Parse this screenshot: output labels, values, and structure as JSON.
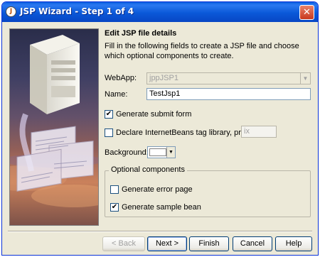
{
  "window": {
    "title": "JSP Wizard - Step 1 of 4",
    "title_icon": "wizard-icon",
    "close_glyph": "✕"
  },
  "header": {
    "heading": "Edit JSP file details",
    "description": "Fill in the following fields to create a JSP file and choose which optional components to create."
  },
  "form": {
    "webapp_label": "WebApp:",
    "webapp_value": "jppJSP1",
    "name_label": "Name:",
    "name_value": "TestJsp1",
    "generate_submit_label": "Generate submit form",
    "generate_submit_checked": true,
    "declare_beans_label": "Declare InternetBeans tag library, prefix:",
    "declare_beans_checked": false,
    "prefix_value": "ix",
    "background_label": "Background:",
    "background_color": "#ffffff"
  },
  "optional": {
    "group_label": "Optional components",
    "error_page_label": "Generate error page",
    "error_page_checked": false,
    "sample_bean_label": "Generate sample bean",
    "sample_bean_checked": true
  },
  "buttons": {
    "back": "< Back",
    "next": "Next >",
    "finish": "Finish",
    "cancel": "Cancel",
    "help": "Help"
  },
  "colors": {
    "titlebar": "#0a58d8",
    "dialog_bg": "#ece9d8",
    "close_button": "#c8381e"
  }
}
